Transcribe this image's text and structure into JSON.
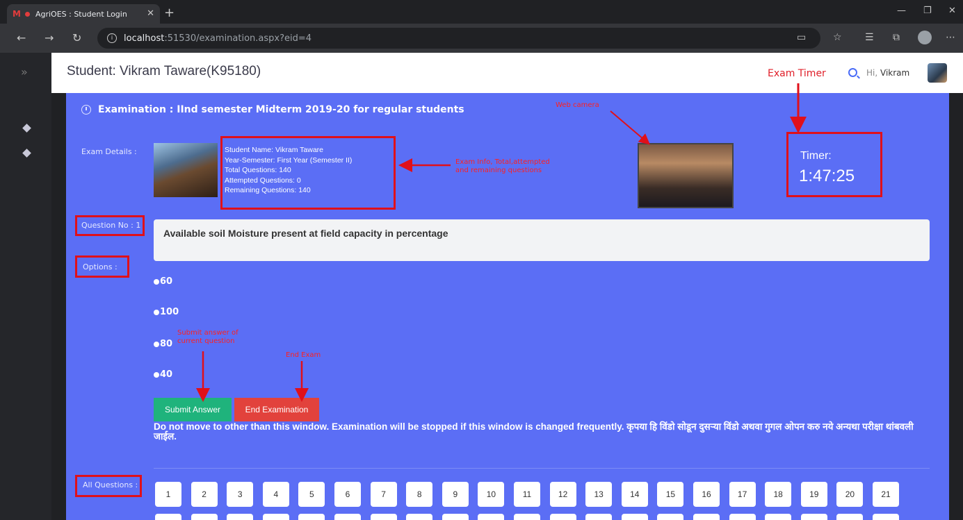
{
  "browser": {
    "tab_title": "AgriOES : Student Login",
    "tab_logo": "M",
    "url_host": "localhost",
    "url_path": ":51530/examination.aspx?eid=4"
  },
  "header": {
    "student_title": "Student: Vikram Taware(K95180)",
    "greeting_prefix": "Hi,",
    "greeting_name": "Vikram"
  },
  "exam": {
    "title": "Examination : IInd semester Midterm 2019-20 for regular students",
    "details_label": "Exam Details :",
    "details": {
      "student_name": "Student Name: Vikram Taware",
      "year_semester": "Year-Semester: First Year (Semester II)",
      "total_questions": "Total Questions: 140",
      "attempted_questions": "Attempted Questions: 0",
      "remaining_questions": "Remaining Questions: 140"
    },
    "timer_label": "Timer:",
    "timer_value": "1:47:25",
    "question_label": "Question No : 1",
    "question_text": "Available soil Moisture present at field capacity in percentage",
    "options_label": "Options :",
    "options": [
      "60",
      "100",
      "80",
      "40"
    ],
    "submit_label": "Submit Answer",
    "end_label": "End Examination",
    "warning": "Do not move to other than this window. Examination will be stopped if this window is changed frequently. कृपया हि विंडो सोडून दुसऱ्या विंडो अथवा गुगल ओपन करु नये अन्यथा परीक्षा थांबवली जाईल.",
    "all_questions_label": "All Questions :",
    "question_numbers": [
      "1",
      "2",
      "3",
      "4",
      "5",
      "6",
      "7",
      "8",
      "9",
      "10",
      "11",
      "12",
      "13",
      "14",
      "15",
      "16",
      "17",
      "18",
      "19",
      "20",
      "21"
    ]
  },
  "annotations": {
    "exam_timer": "Exam Timer",
    "web_camera": "Web camera",
    "exam_info_line1": "Exam Info, Total,attempted",
    "exam_info_line2": "and remaining questions",
    "submit_line1": "Submit answer of",
    "submit_line2": "current question",
    "end_exam": "End Exam"
  },
  "colors": {
    "panel": "#5b6ef5",
    "annotation": "#e0101a",
    "submit": "#1fb37c",
    "end": "#e2423c"
  }
}
